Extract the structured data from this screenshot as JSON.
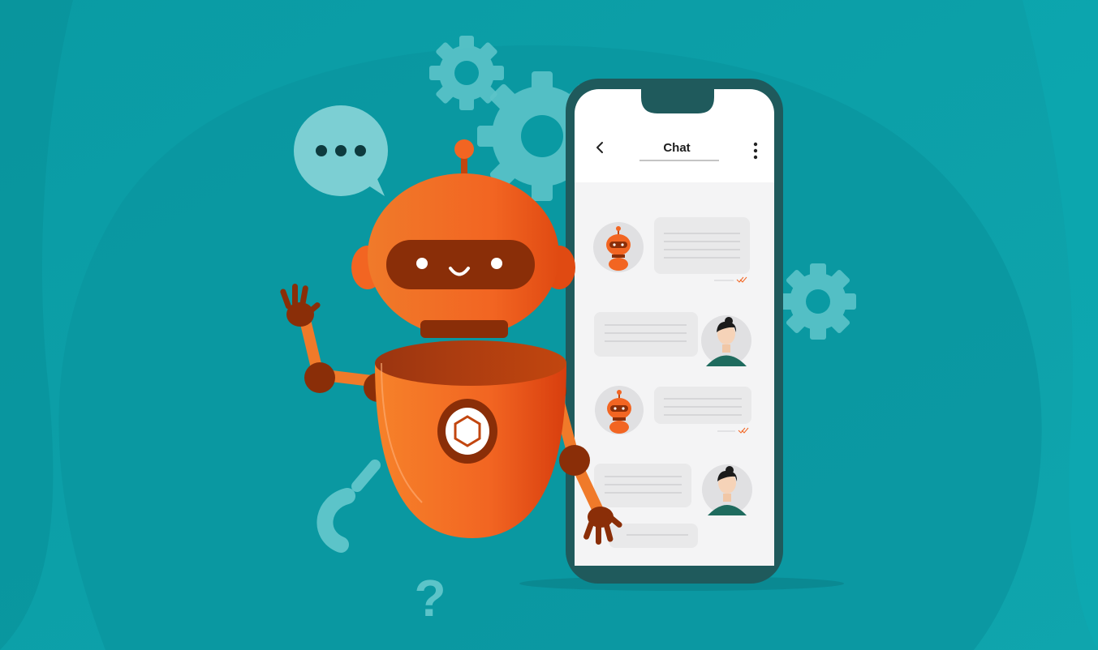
{
  "chat_app": {
    "header_title": "Chat",
    "back_icon": "chevron-left-icon",
    "menu_icon": "vertical-dots-menu-icon"
  },
  "decor": {
    "question_mark": "?"
  },
  "colors": {
    "background": "#0a9da6",
    "robot_orange": "#f26522",
    "robot_dark": "#8a2e08",
    "phone_frame": "#1f5a5c",
    "bubble": "#e9e9ea",
    "gear": "#5cc4c9"
  }
}
